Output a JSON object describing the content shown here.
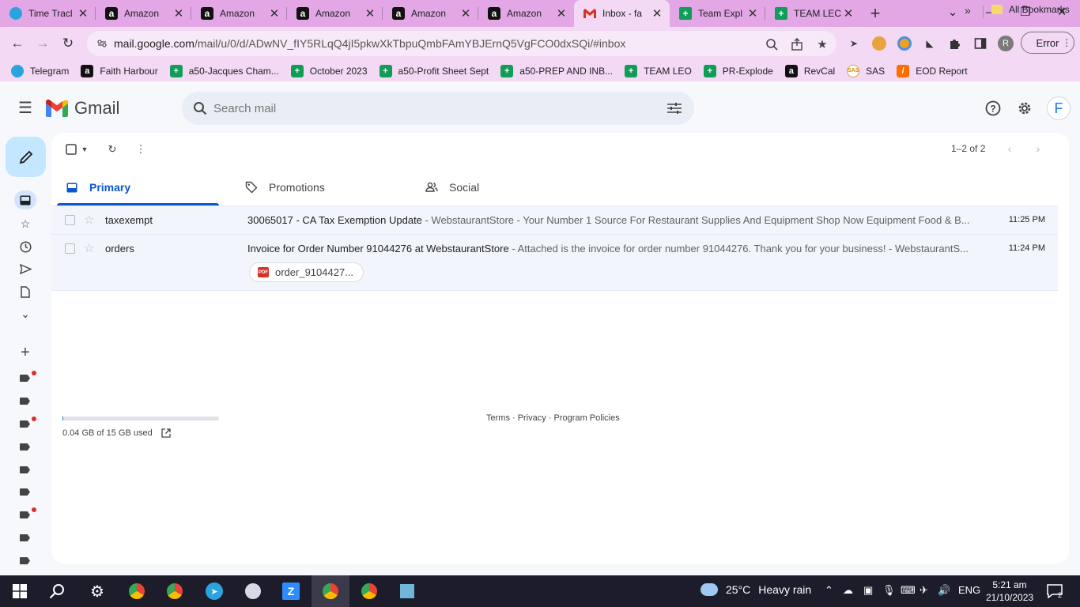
{
  "browser": {
    "tabs": [
      {
        "title": "Time Tracl",
        "icon": "telegram-icon"
      },
      {
        "title": "Amazon",
        "icon": "amazon-icon"
      },
      {
        "title": "Amazon",
        "icon": "amazon-icon"
      },
      {
        "title": "Amazon",
        "icon": "amazon-icon"
      },
      {
        "title": "Amazon",
        "icon": "amazon-icon"
      },
      {
        "title": "Amazon",
        "icon": "amazon-icon"
      },
      {
        "title": "Inbox - fa",
        "icon": "gmail-icon",
        "active": true
      },
      {
        "title": "Team Expl",
        "icon": "sheets-icon"
      },
      {
        "title": "TEAM LEC",
        "icon": "sheets-icon"
      }
    ],
    "url_domain": "mail.google.com",
    "url_path": "/mail/u/0/d/ADwNV_fIY5RLqQ4jI5pkwXkTbpuQmbFAmYBJErnQ5VgFCO0dxSQi/#inbox",
    "error_label": "Error",
    "profile_initial": "R",
    "bookmarks": [
      {
        "label": "Telegram",
        "type": "tg",
        "glyph": ""
      },
      {
        "label": "Faith Harbour",
        "type": "amz",
        "glyph": "a"
      },
      {
        "label": "a50-Jacques Cham...",
        "type": "sh",
        "glyph": "+"
      },
      {
        "label": "October 2023",
        "type": "sh",
        "glyph": "+"
      },
      {
        "label": "a50-Profit Sheet Sept",
        "type": "sh",
        "glyph": "+"
      },
      {
        "label": "a50-PREP AND INB...",
        "type": "sh",
        "glyph": "+"
      },
      {
        "label": "TEAM LEO",
        "type": "sh",
        "glyph": "+"
      },
      {
        "label": "PR-Explode",
        "type": "sh",
        "glyph": "+"
      },
      {
        "label": "RevCal",
        "type": "amz",
        "glyph": "a"
      },
      {
        "label": "SAS",
        "type": "sas",
        "glyph": "SAS"
      },
      {
        "label": "EOD Report",
        "type": "eod",
        "glyph": "/"
      }
    ],
    "bookmarks_more": "»",
    "all_bookmarks": "All Bookmarks"
  },
  "gmail": {
    "logo_text": "Gmail",
    "search_placeholder": "Search mail",
    "account_initial": "F",
    "pager": "1–2 of 2",
    "tabs": [
      {
        "label": "Primary",
        "icon": "inbox-icon"
      },
      {
        "label": "Promotions",
        "icon": "tag-icon"
      },
      {
        "label": "Social",
        "icon": "people-icon"
      }
    ],
    "emails": [
      {
        "sender": "taxexempt",
        "subject": "30065017 - CA Tax Exemption Update",
        "snippet": " - WebstaurantStore - Your Number 1 Source For Restaurant Supplies And Equipment Shop Now Equipment Food & B...",
        "time": "11:25 PM"
      },
      {
        "sender": "orders",
        "subject": "Invoice for Order Number 91044276 at WebstaurantStore",
        "snippet": " - Attached is the invoice for order number 91044276. Thank you for your business! - WebstaurantS...",
        "time": "11:24 PM",
        "attachment": "order_9104427..."
      }
    ],
    "storage_text": "0.04 GB of 15 GB used",
    "storage_fraction": 0.003,
    "footer_links": "Terms · Privacy · Program Policies"
  },
  "taskbar": {
    "weather_temp": "25°C",
    "weather_desc": "Heavy rain",
    "language": "ENG",
    "time": "5:21 am",
    "date": "21/10/2023",
    "notifications": "2"
  }
}
